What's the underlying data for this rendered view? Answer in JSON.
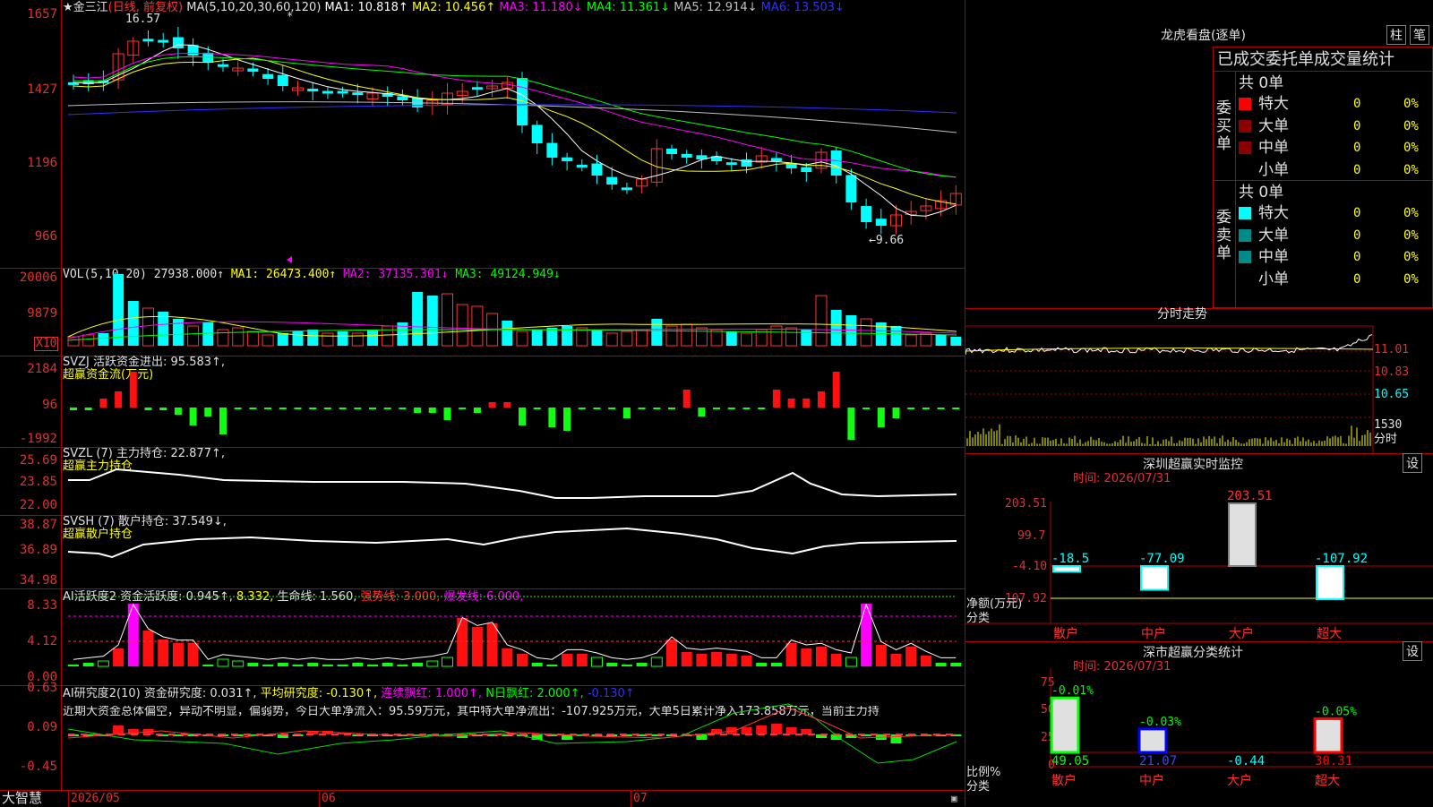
{
  "main_chart": {
    "title_star": "★",
    "stock_name": "金三江",
    "period": "(日线, 前复权)",
    "ma_label": "MA(5,10,20,30,60,120)",
    "ma1": "MA1: 10.818↑",
    "ma2": "MA2: 10.456↑",
    "ma3": "MA3: 11.180↓",
    "ma4": "MA4: 11.361↓",
    "ma5": "MA5: 12.914↓",
    "ma6": "MA6: 13.503↓",
    "high_mark": "16.57",
    "low_mark": "←9.66",
    "y_labels": [
      "1657",
      "1427",
      "1196",
      "966"
    ]
  },
  "vol_panel": {
    "label": "VOL(5,10,20)",
    "value": "27938.000↑",
    "ma1": "MA1: 26473.400↑",
    "ma2": "MA2: 37135.301↓",
    "ma3": "MA3: 49124.949↓",
    "y_labels": [
      "20006",
      "9879"
    ],
    "unit": "X10"
  },
  "svzj_panel": {
    "label": "SVZJ  活跃资金进出: 95.583↑,",
    "sub": "超赢资金流(万元)",
    "y_labels": [
      "2184",
      "96",
      "-1992"
    ]
  },
  "svzl_panel": {
    "label": "SVZL (7) 主力持仓: 22.877↑,",
    "sub": "超赢主力持仓",
    "y_labels": [
      "25.69",
      "23.85",
      "22.00"
    ]
  },
  "svsh_panel": {
    "label": "SVSH (7) 散户持仓: 37.549↓,",
    "sub": "超赢散户持仓",
    "y_labels": [
      "38.87",
      "36.89",
      "34.98"
    ]
  },
  "ai_active_panel": {
    "label": "AI活跃度2 资金活跃度: 0.945↑,",
    "v2": "8.332,",
    "v3": "生命线: 1.560,",
    "v4": "强势线: 3.000,",
    "v5": "爆发线: 6.000,",
    "y_labels": [
      "8.33",
      "4.12",
      "0.00"
    ]
  },
  "ai_research_panel": {
    "label": "AI研究度2(10) 资金研究度: 0.031↑,",
    "avg": "平均研究度: -0.130↑,",
    "cont": "连续飘红: 1.000↑,",
    "nday": "N日飘红: 2.000↑,",
    "last": "-0.130↑",
    "comment": "近期大资金总体偏空，异动不明显，偏弱势，今日大单净流入：95.59万元，其中特大单净流出：-107.925万元，大单5日累计净入173.858万元，当前主力持",
    "y_labels": [
      "0.63",
      "0.09",
      "-0.45"
    ]
  },
  "bottom_bar": {
    "brand": "大智慧",
    "dates": [
      "2026/05",
      "06",
      "07"
    ]
  },
  "lhb": {
    "title": "龙虎看盘(逐单)",
    "btn_bar": "柱",
    "btn_pen": "笔",
    "subtitle": "已成交委托单成交量统计",
    "buy_total": "共 0单",
    "sell_total": "共 0单",
    "buy_label": "委买单",
    "sell_label": "委卖单",
    "rows": [
      "特大",
      "大单",
      "中单",
      "小单"
    ],
    "count": "0",
    "pct": "0%",
    "buy_colors": [
      "#ff0000",
      "#8b0000",
      "#8b0000",
      "#000000"
    ],
    "sell_colors": [
      "#00ffff",
      "#008b8b",
      "#008b8b",
      "#000000"
    ]
  },
  "intraday": {
    "title": "分时走势",
    "prices": [
      "11.01",
      "10.83",
      "10.65"
    ],
    "vol_label": "1530",
    "vol_unit": "分时"
  },
  "sz_monitor": {
    "title": "深圳超赢实时监控",
    "btn": "设",
    "time": "时间: 2026/07/31",
    "y_labels": [
      "203.51",
      "99.7",
      "-4.10",
      "-107.92"
    ],
    "y_title": "净额(万元)",
    "x_title": "分类",
    "categories": [
      "散户",
      "中户",
      "大户",
      "超大"
    ],
    "values": [
      -18.5,
      -77.09,
      203.51,
      -107.92
    ],
    "value_labels": [
      "-18.5",
      "-77.09",
      "203.51",
      "-107.92"
    ]
  },
  "sz_stats": {
    "title": "深市超赢分类统计",
    "btn": "设",
    "time": "时间: 2026/07/31",
    "y_labels": [
      "75",
      "50",
      "25",
      "0"
    ],
    "y_title": "比例%",
    "x_title": "分类",
    "categories": [
      "散户",
      "中户",
      "大户",
      "超大"
    ],
    "values": [
      49.05,
      21.07,
      -0.44,
      30.31
    ],
    "value_labels": [
      "49.05",
      "21.07",
      "-0.44",
      "30.31"
    ],
    "delta_labels": [
      "-0.01%",
      "-0.03%",
      "",
      "-0.05%"
    ],
    "bar_colors": [
      "#00ff00",
      "#0000ff",
      "#ffff00",
      "#ff0000"
    ]
  },
  "colors": {
    "up": "#ff3232",
    "down": "#00ffff",
    "grid": "#b00000",
    "ma1": "#ffffff",
    "ma2": "#ffff00",
    "ma3": "#ff00ff",
    "ma4": "#00ff00",
    "ma5": "#c0c0c0",
    "ma6": "#3030ff"
  }
}
